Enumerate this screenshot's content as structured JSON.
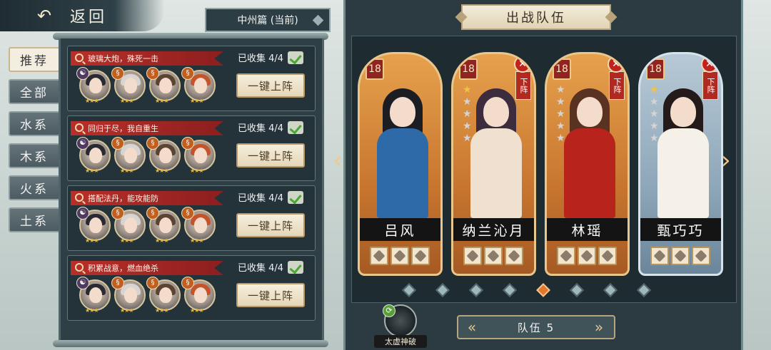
{
  "header": {
    "back_label": "返回",
    "chapter": "中州篇 (当前)"
  },
  "tabs": [
    "推荐",
    "全部",
    "水系",
    "木系",
    "火系",
    "土系"
  ],
  "lineups": [
    {
      "title": "玻璃大炮，殊死一击",
      "collected": "已收集 4/4",
      "button": "一键上阵",
      "avatars": [
        {
          "elem": "water",
          "stars": "★★★"
        },
        {
          "elem": "fire",
          "stars": "★★★"
        },
        {
          "elem": "fire",
          "stars": "★★★"
        },
        {
          "elem": "fire",
          "stars": "★★★"
        }
      ]
    },
    {
      "title": "同归于尽，我自重生",
      "collected": "已收集 4/4",
      "button": "一键上阵",
      "avatars": [
        {
          "elem": "water",
          "stars": "★★★"
        },
        {
          "elem": "fire",
          "stars": "★★★"
        },
        {
          "elem": "fire",
          "stars": "★★★"
        },
        {
          "elem": "fire",
          "stars": "★★★"
        }
      ]
    },
    {
      "title": "搭配法丹，能攻能防",
      "collected": "已收集 4/4",
      "button": "一键上阵",
      "avatars": [
        {
          "elem": "water",
          "stars": "★★★"
        },
        {
          "elem": "fire",
          "stars": "★★★"
        },
        {
          "elem": "fire",
          "stars": "★★★"
        },
        {
          "elem": "fire",
          "stars": "★★★"
        }
      ]
    },
    {
      "title": "积累战意，燃血绝杀",
      "collected": "已收集 4/4",
      "button": "一键上阵",
      "avatars": [
        {
          "elem": "water",
          "stars": "★★★"
        },
        {
          "elem": "fire",
          "stars": "★★★"
        },
        {
          "elem": "fire",
          "stars": "★★★"
        },
        {
          "elem": "fire",
          "stars": "★★★"
        }
      ]
    }
  ],
  "team": {
    "title": "出战队伍",
    "cards": [
      {
        "name": "吕风",
        "level": "18",
        "stars_on": 0,
        "stars_total": 0,
        "removable": false,
        "theme": "orange",
        "hair": "#1b1d22",
        "outfit": "#2f6aa8"
      },
      {
        "name": "纳兰沁月",
        "level": "18",
        "stars_on": 1,
        "stars_total": 5,
        "removable": true,
        "theme": "orange",
        "hair": "#3d2c3e",
        "outfit": "#f0e0cf"
      },
      {
        "name": "林瑶",
        "level": "18",
        "stars_on": 0,
        "stars_total": 5,
        "removable": true,
        "theme": "orange",
        "hair": "#5a3222",
        "outfit": "#b8231c"
      },
      {
        "name": "甄巧巧",
        "level": "18",
        "stars_on": 1,
        "stars_total": 5,
        "removable": true,
        "theme": "blue",
        "hair": "#241a1a",
        "outfit": "#f5f0e8"
      }
    ],
    "remove_label": "下阵",
    "team_label": "队伍 5",
    "skill_label": "太虚神破",
    "dots_total": 8,
    "dot_active": 4
  },
  "icons": {
    "back": "back-arrow-icon",
    "check": "check-icon",
    "remove": "close-icon",
    "refresh": "refresh-icon"
  },
  "colors": {
    "accent": "#e2762a",
    "ribbon": "#b92f2a",
    "panel": "#2c3a41"
  }
}
